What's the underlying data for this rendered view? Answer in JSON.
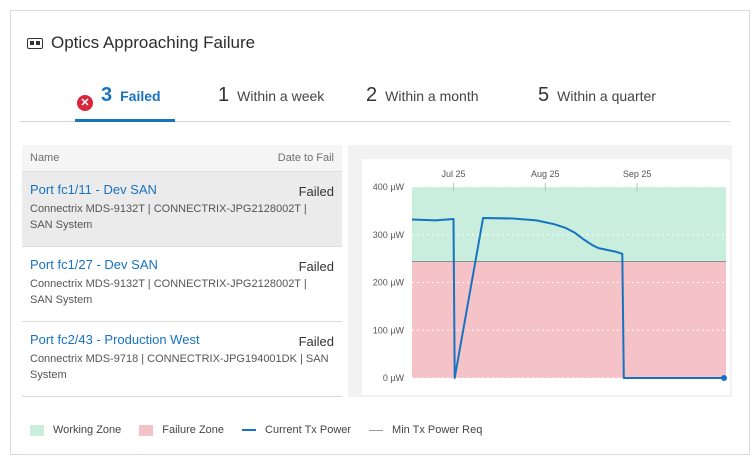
{
  "card": {
    "title": "Optics Approaching Failure",
    "icon": "optic-module-icon"
  },
  "tabs": [
    {
      "count": "3",
      "label": "Failed",
      "active": true,
      "icon": "error-circle-icon"
    },
    {
      "count": "1",
      "label": "Within a week"
    },
    {
      "count": "2",
      "label": "Within a month"
    },
    {
      "count": "5",
      "label": "Within a quarter"
    }
  ],
  "list": {
    "col_name": "Name",
    "col_date": "Date to Fail",
    "rows": [
      {
        "port": "Port fc1/11 - Dev SAN",
        "status": "Failed",
        "meta": "Connectrix MDS-9132T | CONNECTRIX-JPG2128002T | SAN System"
      },
      {
        "port": "Port fc1/27 - Dev SAN",
        "status": "Failed",
        "meta": "Connectrix MDS-9132T | CONNECTRIX-JPG2128002T | SAN System"
      },
      {
        "port": "Port fc2/43 - Production West",
        "status": "Failed",
        "meta": "Connectrix MDS-9718 | CONNECTRIX-JPG194001DK | SAN System"
      }
    ]
  },
  "legend": {
    "working": "Working Zone",
    "failure": "Failure Zone",
    "current": "Current Tx Power",
    "min": "Min Tx Power Req"
  },
  "colors": {
    "accent": "#1773c1",
    "working_zone": "#c9eedd",
    "failure_zone": "#f4c2c7",
    "error": "#d7263d"
  },
  "chart_data": {
    "type": "line",
    "x_tick_labels": [
      "Jul 25",
      "Aug 25",
      "Sep 25"
    ],
    "y_tick_labels": [
      "400 µW",
      "300 µW",
      "200 µW",
      "100 µW",
      "0 µW"
    ],
    "ylim": [
      0,
      400
    ],
    "x_range_days": [
      -14,
      92
    ],
    "working_zone": [
      244,
      400
    ],
    "failure_zone": [
      0,
      244
    ],
    "min_tx_power_req": 244,
    "series": [
      {
        "name": "Current Tx Power",
        "x": [
          -14,
          -6,
          0,
          0.4,
          10,
          20,
          28,
          34,
          38,
          41,
          44,
          47,
          49,
          52,
          55,
          57,
          57.5,
          60,
          70,
          80,
          90,
          92
        ],
        "y": [
          332,
          330,
          333,
          0,
          335,
          334,
          330,
          322,
          314,
          304,
          290,
          278,
          272,
          268,
          264,
          260,
          0,
          0,
          0,
          0,
          0,
          0
        ]
      }
    ],
    "endpoint_marker": {
      "x": 92,
      "y": 0
    }
  }
}
